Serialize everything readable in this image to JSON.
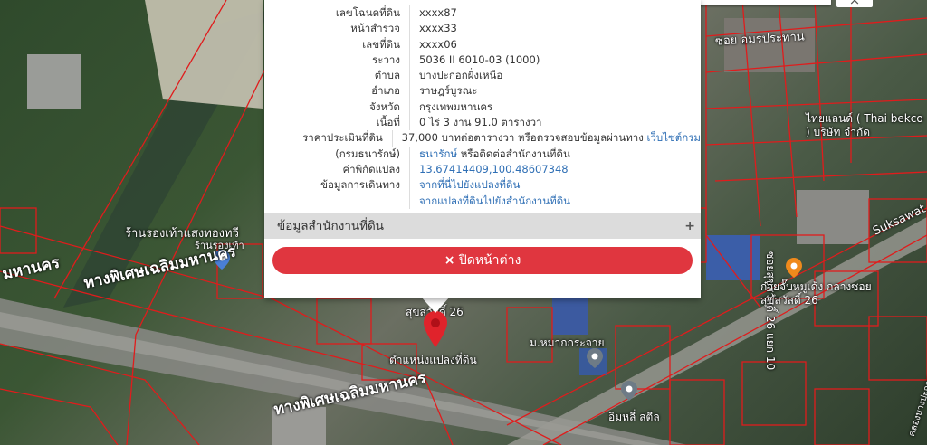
{
  "popup": {
    "rows": [
      {
        "label": "เลขโฉนดที่ดิน",
        "value": "xxxx87"
      },
      {
        "label": "หน้าสำรวจ",
        "value": "xxxx33"
      },
      {
        "label": "เลขที่ดิน",
        "value": "xxxx06"
      },
      {
        "label": "ระวาง",
        "value": "5036 II 6010-03 (1000)"
      },
      {
        "label": "ตำบล",
        "value": "บางปะกอกฝั่งเหนือ"
      },
      {
        "label": "อำเภอ",
        "value": "ราษฎร์บูรณะ"
      },
      {
        "label": "จังหวัด",
        "value": "กรุงเทพมหานคร"
      },
      {
        "label": "เนื้อที่",
        "value": "0 ไร่ 3 งาน 91.0 ตารางวา"
      },
      {
        "label": "ราคาประเมินที่ดิน",
        "value": "37,000 บาทต่อตารางวา หรือตรวจสอบข้อมูลผ่านทาง",
        "link": "เว็บไซต์กรม"
      },
      {
        "label": "(กรมธนารักษ์)",
        "value": "",
        "link": "ธนารักษ์",
        "value_after": " หรือติดต่อสำนักงานที่ดิน"
      },
      {
        "label": "ค่าพิกัดแปลง",
        "value": "",
        "link": "13.67414409,100.48607348"
      },
      {
        "label": "ข้อมูลการเดินทาง",
        "value": "",
        "link": "จากที่นี่ไปยังแปลงที่ดิน"
      },
      {
        "label": "",
        "value": "",
        "link": "จากแปลงที่ดินไปยังสำนักงานที่ดิน"
      }
    ],
    "section_title": "ข้อมูลสำนักงานที่ดิน",
    "section_toggle": "+",
    "close_icon": "×",
    "close_label": "ปิดหน้าต่าง"
  },
  "map": {
    "labels": {
      "shop": "ร้านรองเท้าแสงทองทวี",
      "shop_small": "ร้านรองเท้า",
      "expressway_1": "ทางพิเศษเฉลิมมหานคร",
      "expressway_2": "ทางพิเศษเฉลิมมหานคร",
      "expressway_3": "มหานคร",
      "soi_top": "ซอย อมรประทาน",
      "soi_sukhsawat": "ซอยสุขสวัสดิ์ 26 แยก 10",
      "company": "ไทยแลนด์ ( Thai bekco ) บริษัท จำกัด",
      "road_suksawat": "Suksawat",
      "food_place": "ก๋วยจั๊บหมูเด้ง กลางซอยสุขสวัสดิ์ 26",
      "village": "ม.หมากกระจาย",
      "marker_label": "ตำแหน่งแปลงที่ดิน",
      "soi_26": "สุขสวัสดิ์ 26",
      "imli": "อิมหลี่ สตีล",
      "edge": "คลองบางปะกอก"
    }
  }
}
